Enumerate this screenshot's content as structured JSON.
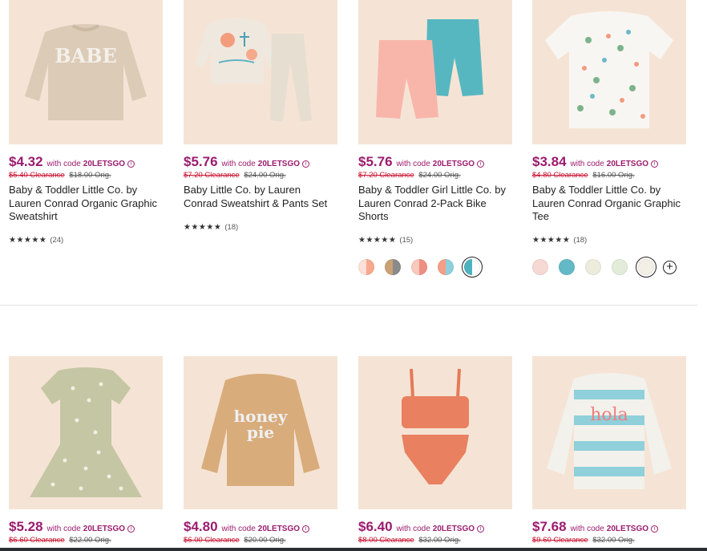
{
  "products": [
    {
      "price": "$4.32",
      "with_code": "with code",
      "code": "20LETSGO",
      "clearance": "$5.40 Clearance",
      "orig": "$18.00 Orig.",
      "title": "Baby & Toddler Little Co. by Lauren Conrad Organic Graphic Sweatshirt",
      "stars": "★★★★★",
      "reviews": "(24)",
      "image": "babe-sweatshirt"
    },
    {
      "price": "$5.76",
      "with_code": "with code",
      "code": "20LETSGO",
      "clearance": "$7.20 Clearance",
      "orig": "$24.00 Orig.",
      "title": "Baby Little Co. by Lauren Conrad Sweatshirt & Pants Set",
      "stars": "★★★★★",
      "reviews": "(18)",
      "image": "sweatshirt-pants-set"
    },
    {
      "price": "$5.76",
      "with_code": "with code",
      "code": "20LETSGO",
      "clearance": "$7.20 Clearance",
      "orig": "$24.00 Orig.",
      "title": "Baby & Toddler Girl Little Co. by Lauren Conrad 2-Pack Bike Shorts",
      "stars": "★★★★★",
      "reviews": "(15)",
      "image": "bike-shorts"
    },
    {
      "price": "$3.84",
      "with_code": "with code",
      "code": "20LETSGO",
      "clearance": "$4.80 Clearance",
      "orig": "$16.00 Orig.",
      "title": "Baby & Toddler Little Co. by Lauren Conrad Organic Graphic Tee",
      "stars": "★★★★★",
      "reviews": "(18)",
      "image": "graphic-tee"
    },
    {
      "price": "$5.28",
      "with_code": "with code",
      "code": "20LETSGO",
      "clearance": "$6.60 Clearance",
      "orig": "$22.00 Orig.",
      "image": "floral-dress"
    },
    {
      "price": "$4.80",
      "with_code": "with code",
      "code": "20LETSGO",
      "clearance": "$6.00 Clearance",
      "orig": "$20.00 Orig.",
      "image": "honey-pie-sweatshirt",
      "graphic_text_1": "honey",
      "graphic_text_2": "pie"
    },
    {
      "price": "$6.40",
      "with_code": "with code",
      "code": "20LETSGO",
      "clearance": "$8.00 Clearance",
      "orig": "$32.00 Orig.",
      "image": "orange-swimsuit"
    },
    {
      "price": "$7.68",
      "with_code": "with code",
      "code": "20LETSGO",
      "clearance": "$9.60 Clearance",
      "orig": "$32.00 Orig.",
      "image": "hola-sweater",
      "graphic_text": "hola"
    }
  ],
  "graphic_babe": "BABE",
  "info_glyph": "i",
  "plus_glyph": "+",
  "swatches_shorts": [
    "#f7a98e|#fde0d8",
    "#8a8a8a|#c9a174",
    "#ef8f84|#f8c9bd",
    "#8fd0dc|#f79e86",
    "#ffffff|#4fb3bf"
  ],
  "swatches_tee": [
    "#f6d9d3",
    "#63b9c6",
    "#ecebdc",
    "#e3ecd8",
    "#f3eee6"
  ],
  "colors": {
    "price": "#9b1b6e",
    "clearance": "#c8102e"
  }
}
